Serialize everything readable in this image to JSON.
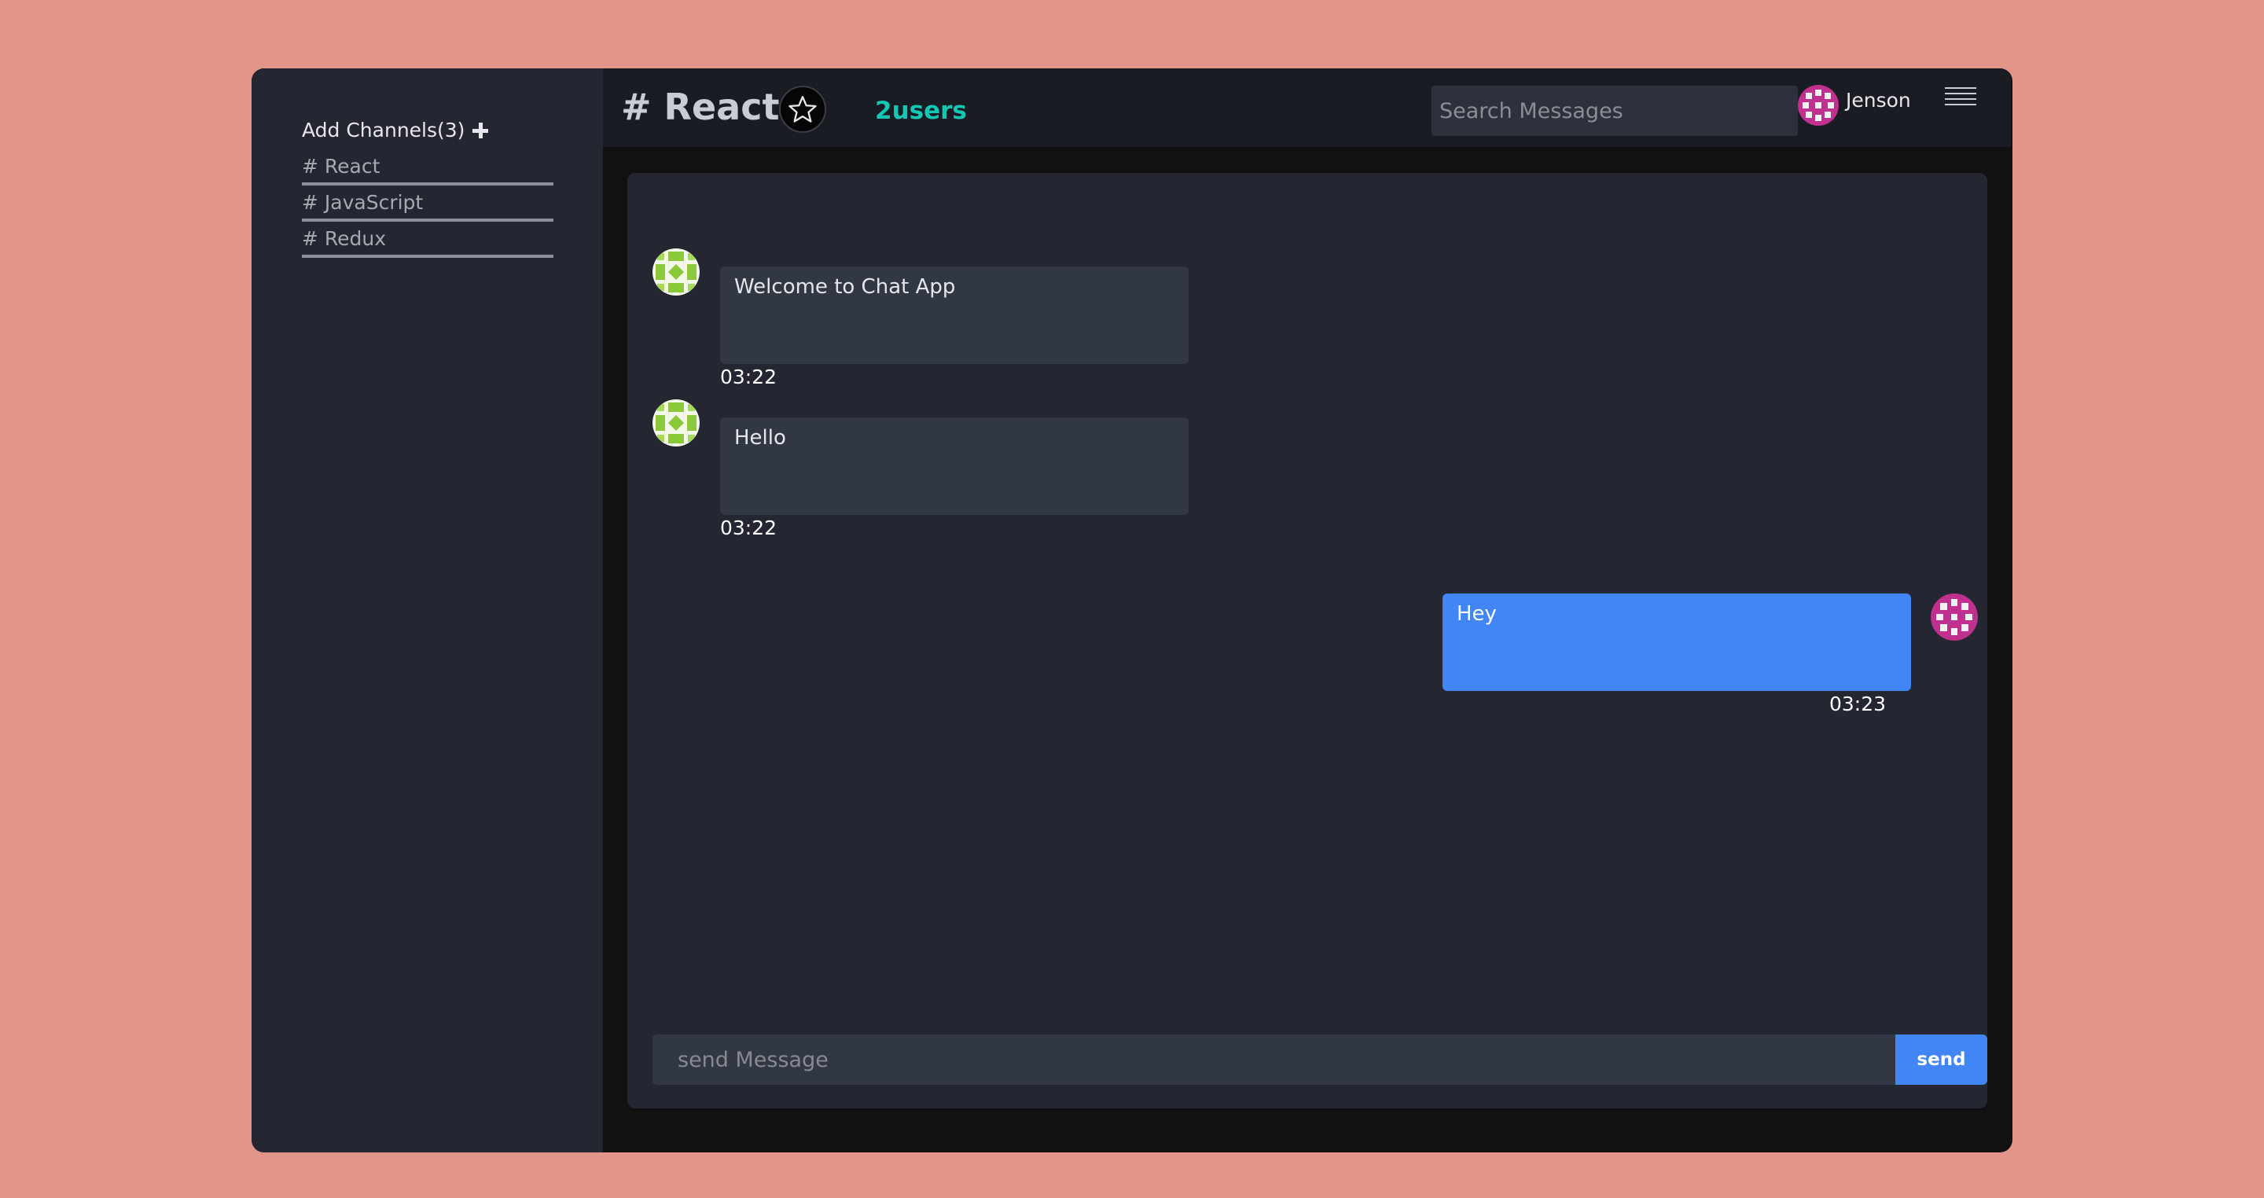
{
  "colors": {
    "page_background": "#e4958a",
    "sidebar": "#242731",
    "header": "#1a1c24",
    "accent": "#4285f4",
    "users_count": "#14c7b2",
    "incoming_bubble": "#323744"
  },
  "sidebar": {
    "add_channels_label": "Add Channels(3)",
    "add_icon": "plus-icon",
    "channels": [
      {
        "label": "# React"
      },
      {
        "label": "# JavaScript"
      },
      {
        "label": "# Redux"
      }
    ]
  },
  "header": {
    "channel_title": "# React",
    "star_icon": "star-outline-icon",
    "users_count": "2users",
    "search_placeholder": "Search Messages",
    "current_user": "Jenson",
    "menu_icon": "hamburger-menu-icon"
  },
  "messages": [
    {
      "text": "Welcome to Chat App",
      "time": "03:22",
      "direction": "incoming",
      "avatar": "green-identicon-avatar"
    },
    {
      "text": "Hello",
      "time": "03:22",
      "direction": "incoming",
      "avatar": "green-identicon-avatar"
    },
    {
      "text": "Hey",
      "time": "03:23",
      "direction": "outgoing",
      "avatar": "pink-identicon-avatar"
    }
  ],
  "composer": {
    "placeholder": "send Message",
    "send_label": "send"
  }
}
